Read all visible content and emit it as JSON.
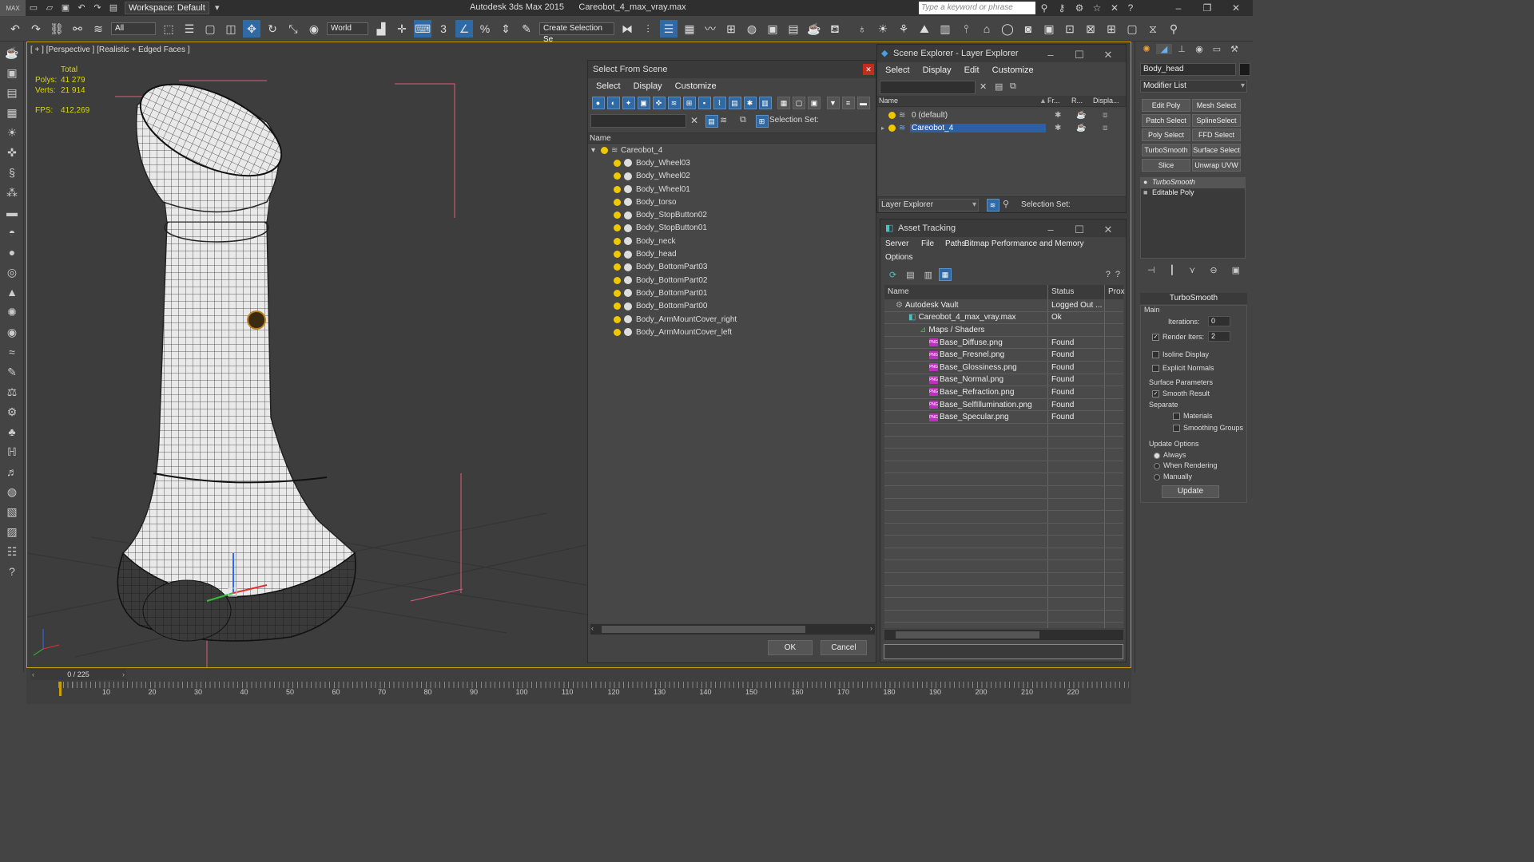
{
  "titlebar": {
    "logo": "MAX",
    "workspace": "Workspace: Default",
    "app_name": "Autodesk 3ds Max  2015",
    "file_name": "Careobot_4_max_vray.max",
    "search_placeholder": "Type a keyword or phrase"
  },
  "toolbar": {
    "filter": "All",
    "coord": "World",
    "selection_set": "Create Selection Se"
  },
  "viewport": {
    "label": "[ + ] [Perspective ] [Realistic + Edged Faces ]",
    "total_label": "Total",
    "polys_label": "Polys:",
    "polys": "41 279",
    "verts_label": "Verts:",
    "verts": "21 914",
    "fps_label": "FPS:",
    "fps": "412,269"
  },
  "select_from_scene": {
    "title": "Select From Scene",
    "menus": [
      "Select",
      "Display",
      "Customize"
    ],
    "selection_set_label": "Selection Set:",
    "column_name": "Name",
    "root": "Careobot_4",
    "items": [
      "Body_Wheel03",
      "Body_Wheel02",
      "Body_Wheel01",
      "Body_torso",
      "Body_StopButton02",
      "Body_StopButton01",
      "Body_neck",
      "Body_head",
      "Body_BottomPart03",
      "Body_BottomPart02",
      "Body_BottomPart01",
      "Body_BottomPart00",
      "Body_ArmMountCover_right",
      "Body_ArmMountCover_left"
    ],
    "ok": "OK",
    "cancel": "Cancel"
  },
  "scene_explorer": {
    "title": "Scene Explorer - Layer Explorer",
    "menus": [
      "Select",
      "Display",
      "Edit",
      "Customize"
    ],
    "col_name": "Name",
    "col_fr": "Fr...",
    "col_r": "R...",
    "col_disp": "Displa...",
    "layers": [
      {
        "name": "0 (default)",
        "selected": false
      },
      {
        "name": "Careobot_4",
        "selected": true
      }
    ],
    "footer_dropdown": "Layer Explorer",
    "footer_selset": "Selection Set:"
  },
  "asset_tracking": {
    "title": "Asset Tracking",
    "menus": [
      "Server",
      "File",
      "Paths",
      "Bitmap Performance and Memory"
    ],
    "menus_row2": [
      "Options"
    ],
    "col_name": "Name",
    "col_status": "Status",
    "col_prox": "Prox",
    "rows": [
      {
        "name": "Autodesk Vault",
        "status": "Logged Out ...",
        "indent": 0,
        "kind": "vault"
      },
      {
        "name": "Careobot_4_max_vray.max",
        "status": "Ok",
        "indent": 1,
        "kind": "max"
      },
      {
        "name": "Maps / Shaders",
        "status": "",
        "indent": 2,
        "kind": "folder"
      },
      {
        "name": "Base_Diffuse.png",
        "status": "Found",
        "indent": 3,
        "kind": "png"
      },
      {
        "name": "Base_Fresnel.png",
        "status": "Found",
        "indent": 3,
        "kind": "png"
      },
      {
        "name": "Base_Glossiness.png",
        "status": "Found",
        "indent": 3,
        "kind": "png"
      },
      {
        "name": "Base_Normal.png",
        "status": "Found",
        "indent": 3,
        "kind": "png"
      },
      {
        "name": "Base_Refraction.png",
        "status": "Found",
        "indent": 3,
        "kind": "png"
      },
      {
        "name": "Base_SelfIllumination.png",
        "status": "Found",
        "indent": 3,
        "kind": "png"
      },
      {
        "name": "Base_Specular.png",
        "status": "Found",
        "indent": 3,
        "kind": "png"
      }
    ],
    "png_badge": "PNG"
  },
  "command_panel": {
    "object_name": "Body_head",
    "modifier_list": "Modifier List",
    "mod_buttons": [
      "Edit Poly",
      "Mesh Select",
      "Patch Select",
      "SplineSelect",
      "Poly Select",
      "FFD Select",
      "TurboSmooth",
      "Surface Select",
      "Slice",
      "Unwrap UVW"
    ],
    "stack": [
      "TurboSmooth",
      "Editable Poly"
    ],
    "rollout_title": "TurboSmooth",
    "main_label": "Main",
    "iterations_label": "Iterations:",
    "iterations": "0",
    "render_iters_label": "Render Iters:",
    "render_iters": "2",
    "isoline": "Isoline Display",
    "explicit_normals": "Explicit Normals",
    "surface_params": "Surface Parameters",
    "smooth_result": "Smooth Result",
    "separate": "Separate",
    "materials": "Materials",
    "smoothing_groups": "Smoothing Groups",
    "update_options": "Update Options",
    "always": "Always",
    "when_rendering": "When Rendering",
    "manually": "Manually",
    "update": "Update"
  },
  "timeline": {
    "frame": "0 / 225",
    "ticks": [
      "10",
      "20",
      "30",
      "40",
      "50",
      "60",
      "70",
      "80",
      "90",
      "100",
      "110",
      "120",
      "130",
      "140",
      "150",
      "160",
      "170",
      "180",
      "190",
      "200",
      "210",
      "220"
    ]
  },
  "colors": {
    "accent": "#2b5fa8",
    "viewport_border": "#c8a000",
    "stats": "#d8d800",
    "bulb": "#f0c800"
  }
}
